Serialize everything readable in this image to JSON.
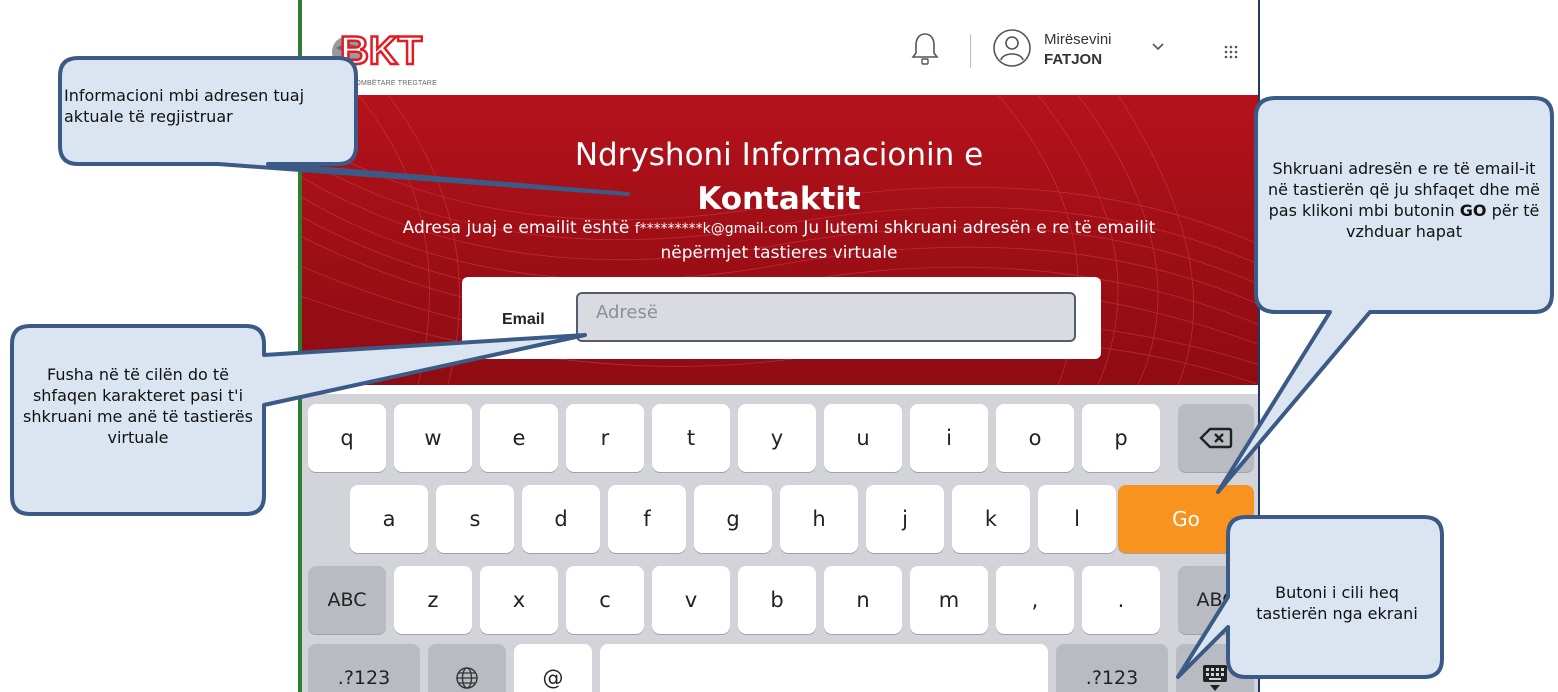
{
  "header": {
    "logo_text": "BKT",
    "logo_tagline": "BANKA KOMBËTARE TREGTARE",
    "greeting": "Mirësevini",
    "user_name": "FATJON"
  },
  "hero": {
    "title_line1": "Ndryshoni Informacionin e",
    "title_line2": "Kontaktit",
    "subtitle_prefix": "Adresa juaj e emailit është",
    "masked_email": "f*********k@gmail.com",
    "subtitle_suffix": "Ju lutemi shkruani adresën e re të emailit",
    "subtitle_line2": "nëpërmjet tastieres virtuale"
  },
  "form": {
    "email_label": "Email",
    "email_placeholder": "Adresë",
    "email_value": ""
  },
  "keyboard": {
    "row1": [
      "q",
      "w",
      "e",
      "r",
      "t",
      "y",
      "u",
      "i",
      "o",
      "p"
    ],
    "row2": [
      "a",
      "s",
      "d",
      "f",
      "g",
      "h",
      "j",
      "k",
      "l"
    ],
    "row3": [
      "z",
      "x",
      "c",
      "v",
      "b",
      "n",
      "m",
      ",",
      "."
    ],
    "shift_left_label": "ABC",
    "shift_right_label": "ABC",
    "go_label": "Go",
    "numbers_left_label": ".?123",
    "numbers_right_label": ".?123",
    "at_label": "@",
    "icons": {
      "backspace": "backspace-icon",
      "globe": "globe-icon",
      "hide": "hide-keyboard-icon"
    }
  },
  "callouts": {
    "current_address": "Informacioni mbi adresen tuaj aktuale të regjistruar",
    "field": "Fusha në të cilën do të shfaqen karakteret pasi t'i shkruani me anë të tastierës virtuale",
    "go_part1": "Shkruani adresën e re të email-it në tastierën që ju shfaqet dhe më pas klikoni mbi butonin",
    "go_bold": "GO",
    "go_part2": "për të vzhduar hapat",
    "hide": "Butoni i cili heq tastierën nga ekrani"
  },
  "colors": {
    "hero_red": "#a30f17",
    "go_orange": "#f7931e",
    "callout_fill": "#dbe5f1",
    "callout_border": "#3b5a86"
  }
}
